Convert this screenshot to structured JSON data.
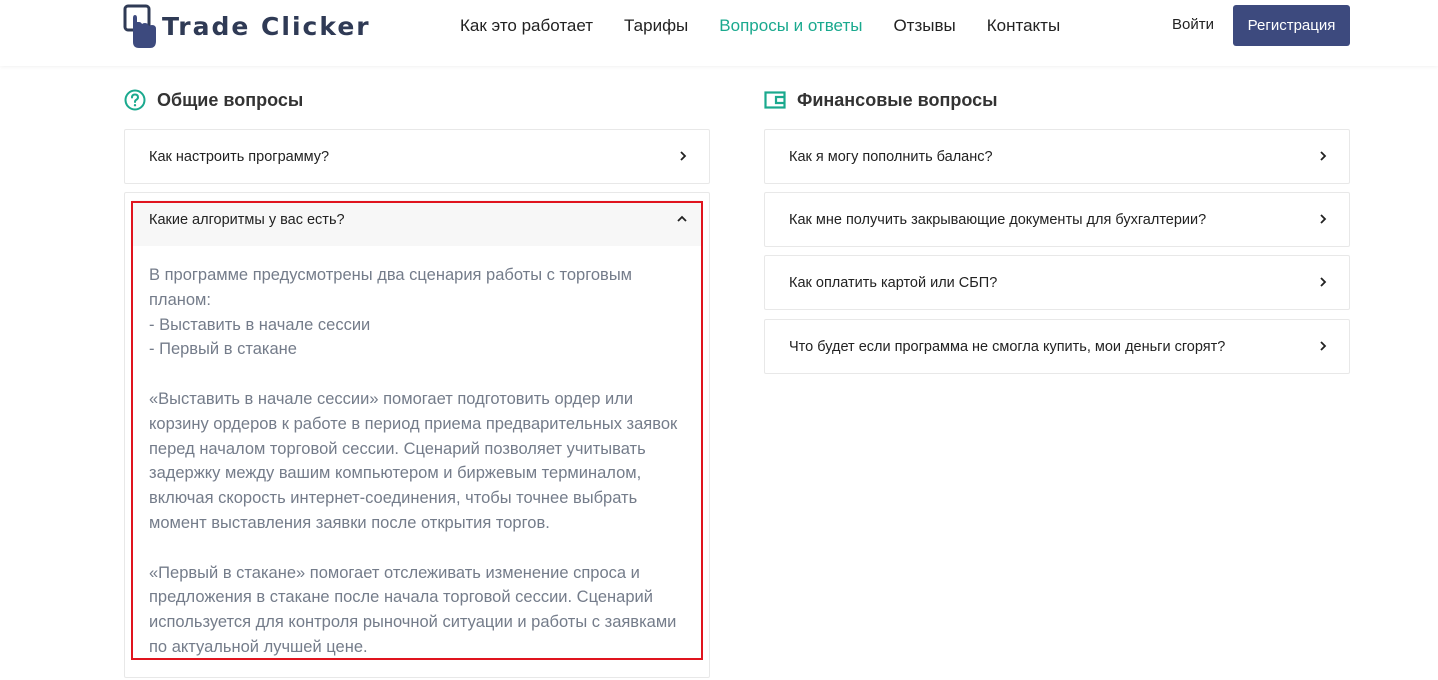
{
  "header": {
    "logo_text": "Trade Clicker",
    "nav": [
      {
        "label": "Как это работает",
        "active": false
      },
      {
        "label": "Тарифы",
        "active": false
      },
      {
        "label": "Вопросы и ответы",
        "active": true
      },
      {
        "label": "Отзывы",
        "active": false
      },
      {
        "label": "Контакты",
        "active": false
      }
    ],
    "login_label": "Войти",
    "register_label": "Регистрация"
  },
  "general": {
    "title": "Общие вопросы",
    "icon": "question-circle-icon",
    "items": [
      {
        "question": "Как настроить программу?"
      }
    ],
    "open_item": {
      "question": "Какие алгоритмы у вас есть?",
      "answer_lines": [
        "В программе предусмотрены два сценария работы с торговым",
        "планом:",
        "- Выставить в начале сессии",
        "- Первый в стакане"
      ],
      "answer_p2": "«Выставить в начале сессии» помогает подготовить ордер или корзину ордеров к работе в период приема предварительных заявок перед началом торговой сессии. Сценарий позволяет учитывать задержку между вашим компьютером и биржевым терминалом, включая скорость интернет-соединения, чтобы точнее выбрать момент выставления заявки после открытия торгов.",
      "answer_p3": "«Первый в стакане» помогает отслеживать изменение спроса и предложения в стакане после начала торговой сессии. Сценарий используется для контроля рыночной ситуации и работы с заявками по актуальной лучшей цене."
    }
  },
  "finance": {
    "title": "Финансовые вопросы",
    "icon": "wallet-icon",
    "items": [
      {
        "question": "Как я могу пополнить баланс?"
      },
      {
        "question": "Как мне получить закрывающие документы для бухгалтерии?"
      },
      {
        "question": "Как оплатить картой или СБП?"
      },
      {
        "question": "Что будет если программа не смогла купить, мои деньги сгорят?"
      }
    ]
  },
  "colors": {
    "accent": "#1aa98e",
    "button": "#3d4a7e",
    "highlight": "#e0141e",
    "answer_text": "#747c8a"
  }
}
